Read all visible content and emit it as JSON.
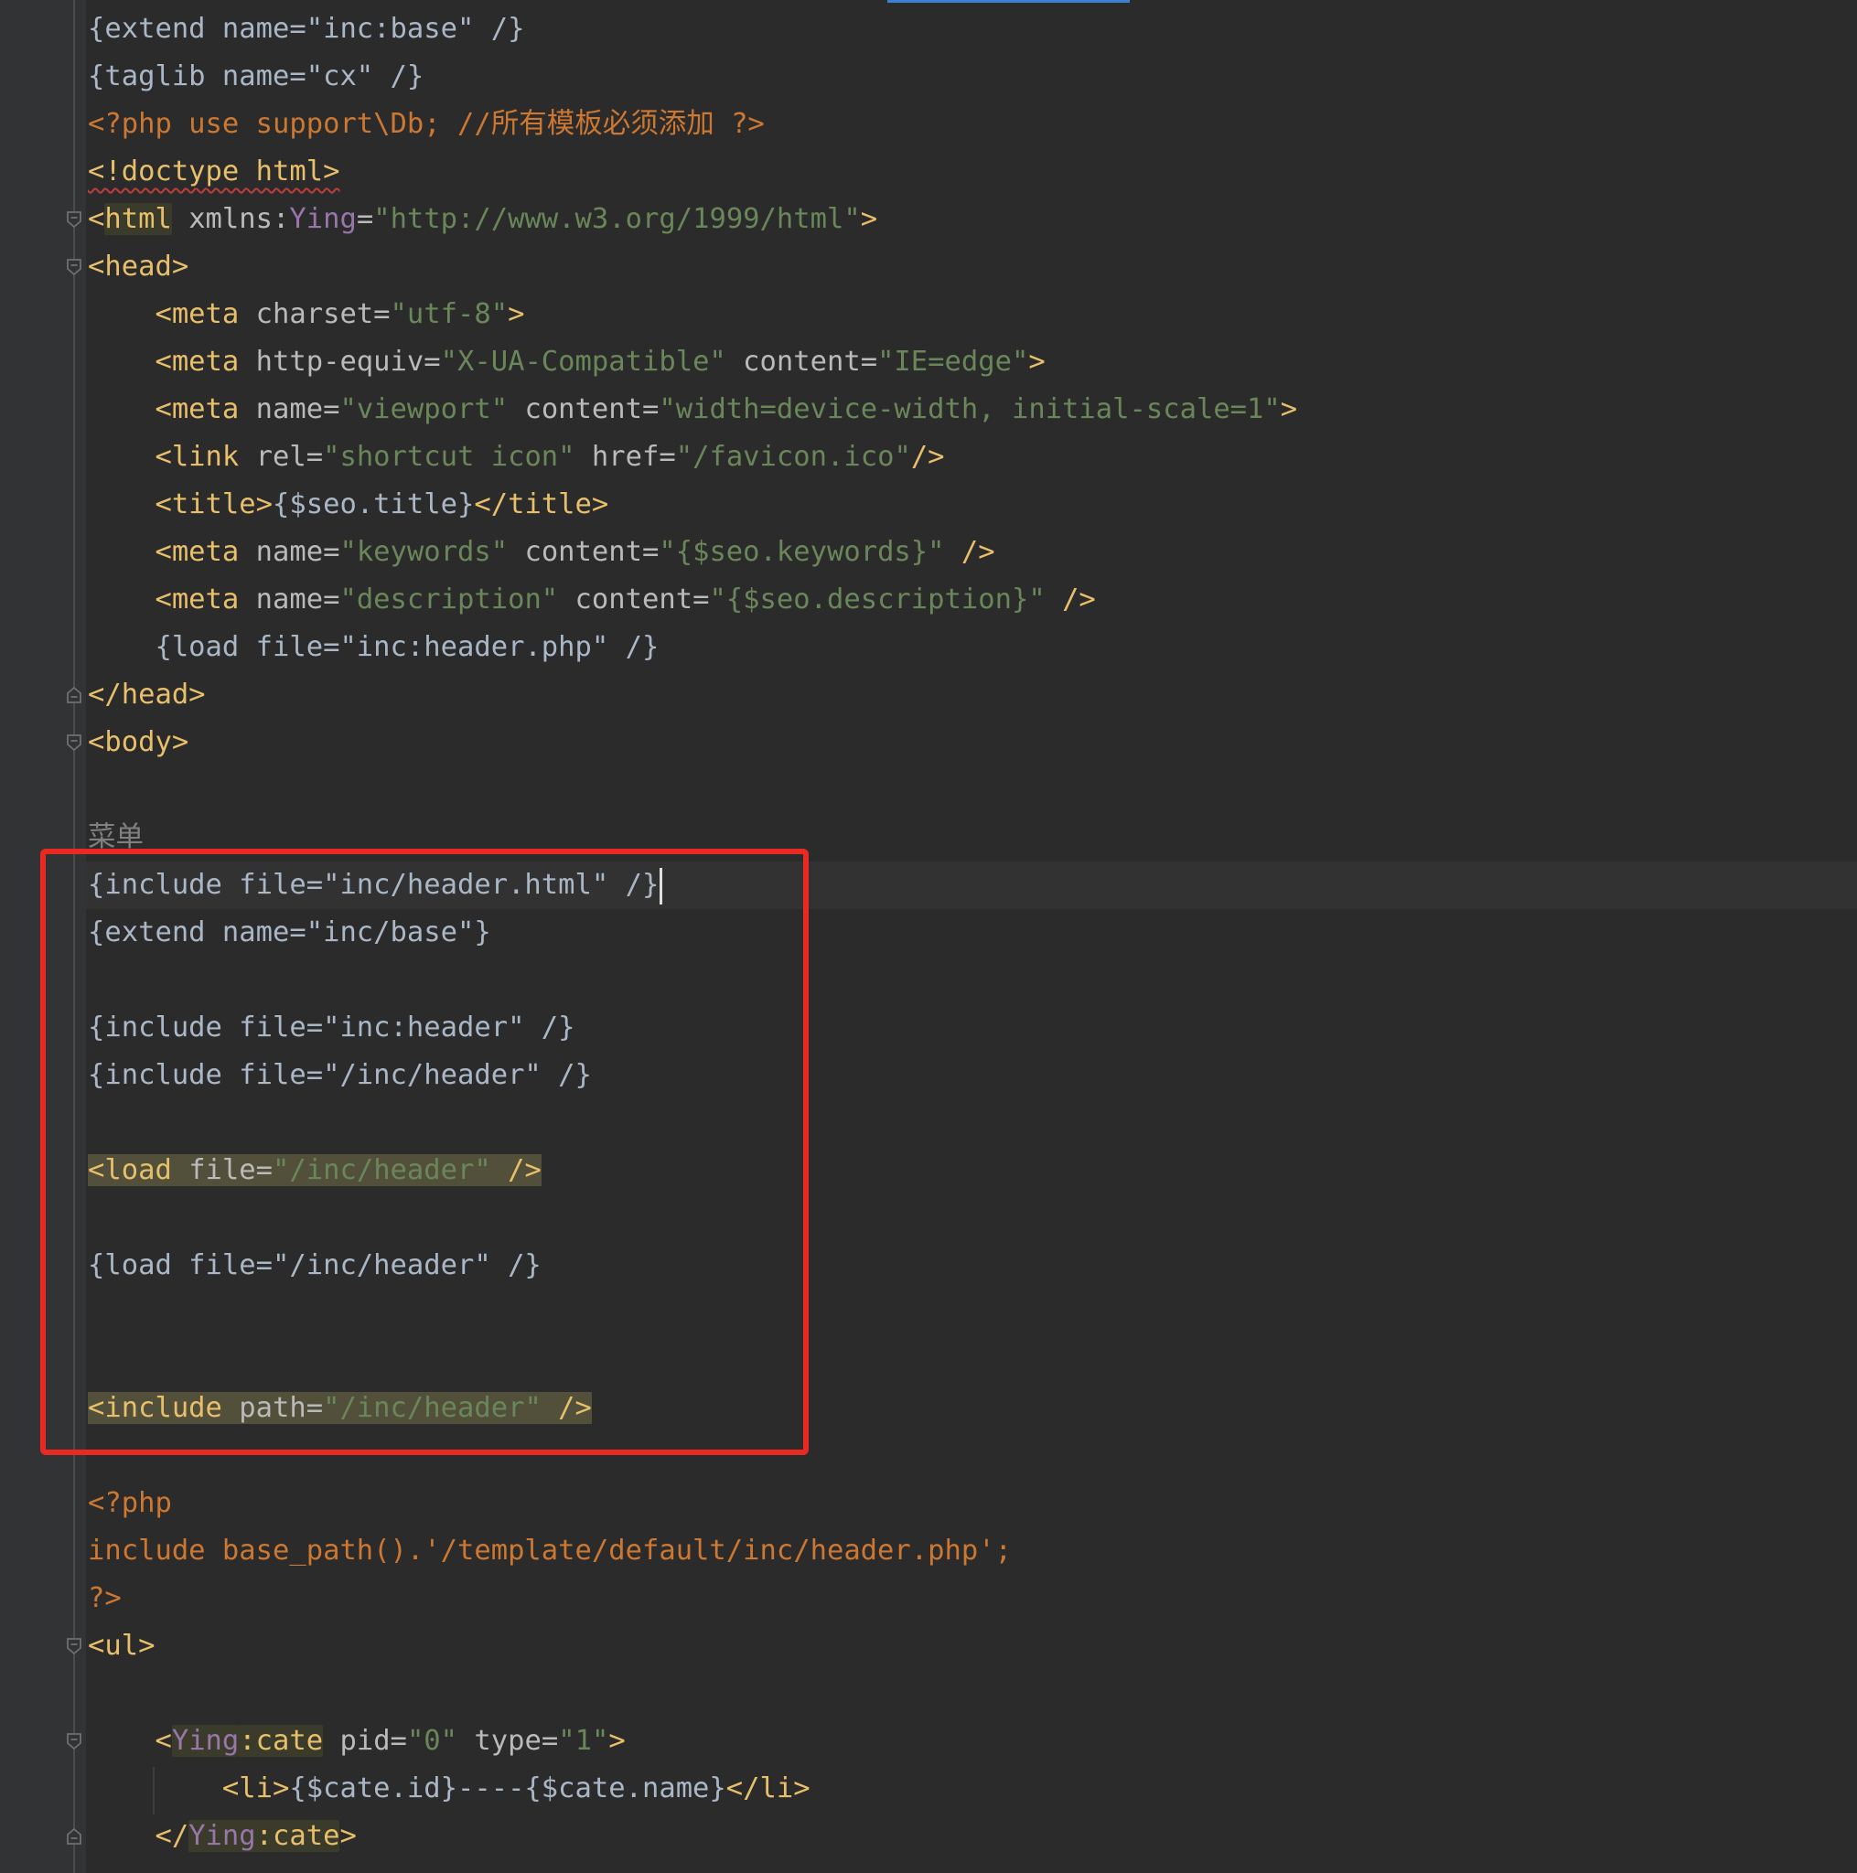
{
  "editor": {
    "lines": [
      {
        "segments": [
          {
            "t": "{extend name=\"inc:base\" /}",
            "c": "txt"
          }
        ]
      },
      {
        "segments": [
          {
            "t": "{taglib name=\"cx\" /}",
            "c": "txt"
          }
        ]
      },
      {
        "segments": [
          {
            "t": "<?php use support\\Db; //",
            "c": "kw"
          },
          {
            "t": "所有模板必须添加",
            "c": "kw cjk"
          },
          {
            "t": " ?>",
            "c": "kw"
          }
        ]
      },
      {
        "segments": [
          {
            "t": "<!doctype html>",
            "c": "tag squiggle"
          }
        ]
      },
      {
        "segments": [
          {
            "t": "<",
            "c": "tag"
          },
          {
            "t": "html",
            "c": "tag hl-tag"
          },
          {
            "t": " xmlns:",
            "c": "attr"
          },
          {
            "t": "Ying",
            "c": "ns"
          },
          {
            "t": "=",
            "c": "attr"
          },
          {
            "t": "\"http://www.w3.org/1999/html\"",
            "c": "str"
          },
          {
            "t": ">",
            "c": "tag"
          }
        ]
      },
      {
        "segments": [
          {
            "t": "<head>",
            "c": "tag"
          }
        ]
      },
      {
        "segments": [
          {
            "t": "    <meta",
            "c": "tag"
          },
          {
            "t": " charset=",
            "c": "attr"
          },
          {
            "t": "\"utf-8\"",
            "c": "str"
          },
          {
            "t": ">",
            "c": "tag"
          }
        ]
      },
      {
        "segments": [
          {
            "t": "    <meta",
            "c": "tag"
          },
          {
            "t": " http-equiv=",
            "c": "attr"
          },
          {
            "t": "\"X-UA-Compatible\"",
            "c": "str"
          },
          {
            "t": " content=",
            "c": "attr"
          },
          {
            "t": "\"IE=edge\"",
            "c": "str"
          },
          {
            "t": ">",
            "c": "tag"
          }
        ]
      },
      {
        "segments": [
          {
            "t": "    <meta",
            "c": "tag"
          },
          {
            "t": " name=",
            "c": "attr"
          },
          {
            "t": "\"viewport\"",
            "c": "str"
          },
          {
            "t": " content=",
            "c": "attr"
          },
          {
            "t": "\"width=device-width, initial-scale=1\"",
            "c": "str"
          },
          {
            "t": ">",
            "c": "tag"
          }
        ]
      },
      {
        "segments": [
          {
            "t": "    <link",
            "c": "tag"
          },
          {
            "t": " rel=",
            "c": "attr"
          },
          {
            "t": "\"shortcut icon\"",
            "c": "str"
          },
          {
            "t": " href=",
            "c": "attr"
          },
          {
            "t": "\"/favicon.ico\"",
            "c": "str"
          },
          {
            "t": "/>",
            "c": "tag"
          }
        ]
      },
      {
        "segments": [
          {
            "t": "    <title>",
            "c": "tag"
          },
          {
            "t": "{$seo.title}",
            "c": "txt"
          },
          {
            "t": "</title>",
            "c": "tag"
          }
        ]
      },
      {
        "segments": [
          {
            "t": "    <meta",
            "c": "tag"
          },
          {
            "t": " name=",
            "c": "attr"
          },
          {
            "t": "\"keywords\"",
            "c": "str"
          },
          {
            "t": " content=",
            "c": "attr"
          },
          {
            "t": "\"{$seo.keywords}\"",
            "c": "str"
          },
          {
            "t": " />",
            "c": "tag"
          }
        ]
      },
      {
        "segments": [
          {
            "t": "    <meta",
            "c": "tag"
          },
          {
            "t": " name=",
            "c": "attr"
          },
          {
            "t": "\"description\"",
            "c": "str"
          },
          {
            "t": " content=",
            "c": "attr"
          },
          {
            "t": "\"{$seo.description}\"",
            "c": "str"
          },
          {
            "t": " />",
            "c": "tag"
          }
        ]
      },
      {
        "segments": [
          {
            "t": "    {load file=\"inc:header.php\" /}",
            "c": "txt"
          }
        ]
      },
      {
        "segments": [
          {
            "t": "</head>",
            "c": "tag"
          }
        ]
      },
      {
        "segments": [
          {
            "t": "<body>",
            "c": "tag"
          }
        ]
      },
      {
        "segments": []
      },
      {
        "segments": [
          {
            "t": "菜单",
            "c": "cm cjk"
          }
        ]
      },
      {
        "segments": [
          {
            "t": "{include file=\"inc/header.html\" /}",
            "c": "txt"
          }
        ],
        "caret": true
      },
      {
        "segments": [
          {
            "t": "{extend name=\"inc/base\"}",
            "c": "txt"
          }
        ]
      },
      {
        "segments": []
      },
      {
        "segments": [
          {
            "t": "{include file=\"inc:header\" /}",
            "c": "txt"
          }
        ]
      },
      {
        "segments": [
          {
            "t": "{include file=\"/inc/header\" /}",
            "c": "txt"
          }
        ]
      },
      {
        "segments": []
      },
      {
        "segments": [
          {
            "t": "<load",
            "c": "tag hl-olive"
          },
          {
            "t": " file=",
            "c": "attr hl-olive"
          },
          {
            "t": "\"/inc/header\"",
            "c": "str hl-olive"
          },
          {
            "t": " />",
            "c": "tag hl-olive"
          }
        ]
      },
      {
        "segments": []
      },
      {
        "segments": [
          {
            "t": "{load file=\"/inc/header\" /}",
            "c": "txt"
          }
        ]
      },
      {
        "segments": []
      },
      {
        "segments": []
      },
      {
        "segments": [
          {
            "t": "<include",
            "c": "tag hl-olive"
          },
          {
            "t": " path=",
            "c": "attr hl-olive"
          },
          {
            "t": "\"/inc/header\"",
            "c": "str hl-olive"
          },
          {
            "t": " />",
            "c": "tag hl-olive"
          }
        ]
      },
      {
        "segments": []
      },
      {
        "segments": [
          {
            "t": "<?php",
            "c": "kw"
          }
        ]
      },
      {
        "segments": [
          {
            "t": "include base_path().'/template/default/inc/header.php';",
            "c": "kw"
          }
        ]
      },
      {
        "segments": [
          {
            "t": "?>",
            "c": "kw"
          }
        ]
      },
      {
        "segments": [
          {
            "t": "<ul>",
            "c": "tag"
          }
        ]
      },
      {
        "segments": []
      },
      {
        "segments": [
          {
            "t": "    <",
            "c": "tag"
          },
          {
            "t": "Ying",
            "c": "ns hl-tag"
          },
          {
            "t": ":cate",
            "c": "tag hl-tag"
          },
          {
            "t": " pid=",
            "c": "attr"
          },
          {
            "t": "\"0\"",
            "c": "str"
          },
          {
            "t": " type=",
            "c": "attr"
          },
          {
            "t": "\"1\"",
            "c": "str"
          },
          {
            "t": ">",
            "c": "tag"
          }
        ]
      },
      {
        "segments": [
          {
            "t": "        <li>",
            "c": "tag"
          },
          {
            "t": "{$cate.id}----{$cate.name}",
            "c": "txt"
          },
          {
            "t": "</li>",
            "c": "tag"
          }
        ]
      },
      {
        "segments": [
          {
            "t": "    </",
            "c": "tag"
          },
          {
            "t": "Ying",
            "c": "ns hl-tag"
          },
          {
            "t": ":cate",
            "c": "tag hl-tag"
          },
          {
            "t": ">",
            "c": "tag"
          }
        ]
      }
    ],
    "fold_markers": [
      {
        "line": 4,
        "kind": "open"
      },
      {
        "line": 5,
        "kind": "open"
      },
      {
        "line": 14,
        "kind": "close"
      },
      {
        "line": 15,
        "kind": "open"
      },
      {
        "line": 34,
        "kind": "open"
      },
      {
        "line": 36,
        "kind": "open"
      },
      {
        "line": 38,
        "kind": "close"
      }
    ]
  },
  "annotation": {
    "color": "#ea2a22"
  }
}
